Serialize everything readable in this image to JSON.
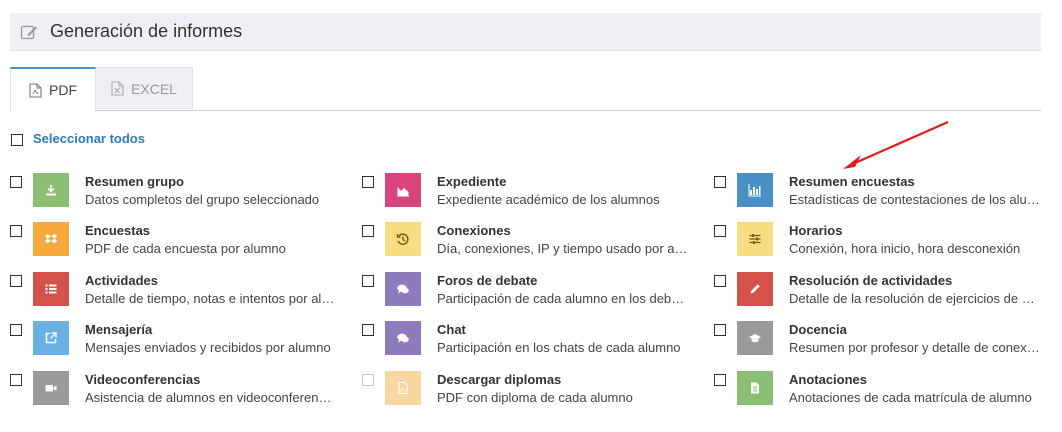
{
  "header": {
    "title": "Generación de informes"
  },
  "tabs": [
    {
      "label": "PDF",
      "active": true
    },
    {
      "label": "EXCEL",
      "active": false
    }
  ],
  "select_all": {
    "label": "Seleccionar todos"
  },
  "colors": {
    "green": "#8cbf73",
    "pink": "#d9457a",
    "blue": "#4a90c6",
    "orange": "#f5a93c",
    "yellow": "#f7dc81",
    "red": "#d5524a",
    "purple": "#8e7bbd",
    "lightblue": "#6ab0e3",
    "gray": "#9a9a9a",
    "peach": "#f9d5a0",
    "accent": "#2e7bb8",
    "arrow": "#e01e1e"
  },
  "reports": [
    {
      "name": "Resumen grupo",
      "desc": "Datos completos del grupo seleccionado",
      "icon": "download-icon",
      "color": "#8cbf73"
    },
    {
      "name": "Expediente",
      "desc": "Expediente académico de los alumnos",
      "icon": "area-chart-icon",
      "color": "#d9457a"
    },
    {
      "name": "Resumen encuestas",
      "desc": "Estadísticas de contestaciones de los alumnos",
      "icon": "bar-chart-icon",
      "color": "#4a90c6"
    },
    {
      "name": "Encuestas",
      "desc": "PDF de cada encuesta por alumno",
      "icon": "dropbox-icon",
      "color": "#f5a93c"
    },
    {
      "name": "Conexiones",
      "desc": "Día, conexiones, IP y tiempo usado por alumno",
      "icon": "history-icon",
      "color": "#f7dc81"
    },
    {
      "name": "Horarios",
      "desc": "Conexión, hora inicio, hora desconexión",
      "icon": "sliders-icon",
      "color": "#f7dc81"
    },
    {
      "name": "Actividades",
      "desc": "Detalle de tiempo, notas e intentos por alumno",
      "icon": "list-icon",
      "color": "#d5524a"
    },
    {
      "name": "Foros de debate",
      "desc": "Participación de cada alumno en los debates",
      "icon": "comments-icon",
      "color": "#8e7bbd"
    },
    {
      "name": "Resolución de actividades",
      "desc": "Detalle de la resolución de ejercicios de cada alumno",
      "icon": "pencil-icon",
      "color": "#d5524a"
    },
    {
      "name": "Mensajería",
      "desc": "Mensajes enviados y recibidos por alumno",
      "icon": "external-link-icon",
      "color": "#6ab0e3"
    },
    {
      "name": "Chat",
      "desc": "Participación en los chats de cada alumno",
      "icon": "comments-icon",
      "color": "#8e7bbd"
    },
    {
      "name": "Docencia",
      "desc": "Resumen por profesor y detalle de conexiones",
      "icon": "graduation-cap-icon",
      "color": "#9a9a9a"
    },
    {
      "name": "Videoconferencias",
      "desc": "Asistencia de alumnos en videoconferencias",
      "icon": "video-camera-icon",
      "color": "#9a9a9a"
    },
    {
      "name": "Descargar diplomas",
      "desc": "PDF con diploma de cada alumno",
      "icon": "pdf-file-icon",
      "color": "#f9d5a0",
      "disabled": true
    },
    {
      "name": "Anotaciones",
      "desc": "Anotaciones de cada matrícula de alumno",
      "icon": "document-icon",
      "color": "#8cbf73"
    }
  ]
}
